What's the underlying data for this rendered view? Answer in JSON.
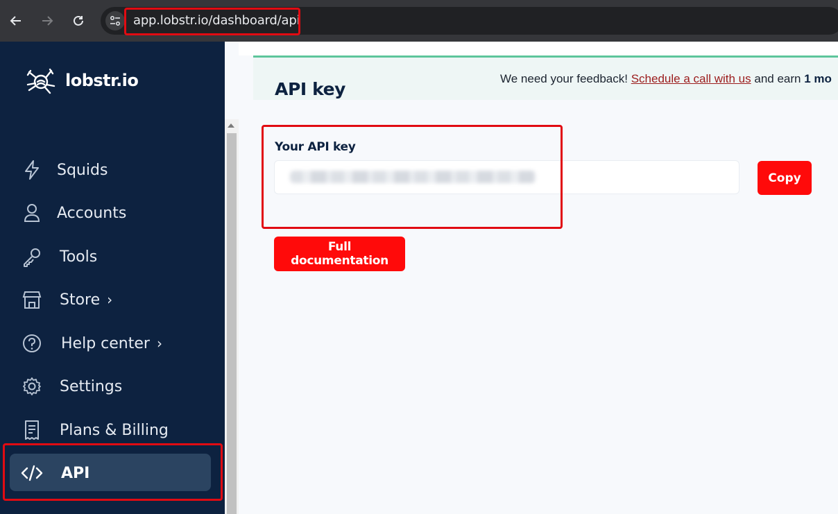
{
  "browser": {
    "url": "app.lobstr.io/dashboard/api",
    "back_icon": "arrow-left-icon",
    "forward_icon": "arrow-right-icon",
    "reload_icon": "reload-icon",
    "site_info_icon": "tune-icon"
  },
  "sidebar": {
    "brand": "lobstr.io",
    "items": [
      {
        "label": "Squids",
        "icon": "bolt-icon"
      },
      {
        "label": "Accounts",
        "icon": "user-icon"
      },
      {
        "label": "Tools",
        "icon": "key-icon"
      },
      {
        "label": "Store",
        "icon": "store-icon",
        "chevron": "›"
      },
      {
        "label": "Help center",
        "icon": "help-circle-icon",
        "chevron": "›"
      },
      {
        "label": "Settings",
        "icon": "gear-icon"
      },
      {
        "label": "Plans & Billing",
        "icon": "receipt-icon"
      },
      {
        "label": "API",
        "icon": "code-icon",
        "active": true
      }
    ]
  },
  "banner": {
    "text_before": "We need your feedback! ",
    "link_text": "Schedule a call with us",
    "text_after": " and earn ",
    "bold_text": "1 mo"
  },
  "main": {
    "title": "API key",
    "key_label": "Your API key",
    "copy_label": "Copy",
    "docs_label": "Full documentation"
  },
  "colors": {
    "sidebar_bg": "#0d2240",
    "active_item_bg": "#2b4461",
    "accent_red": "#ff0a0a",
    "highlight_red": "#e10b12",
    "banner_border": "#5dc59b"
  }
}
